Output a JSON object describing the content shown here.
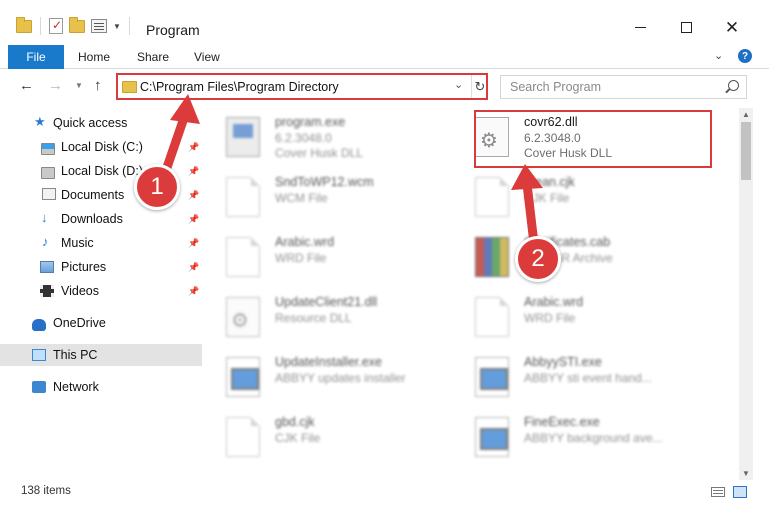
{
  "window": {
    "title": "Program",
    "controls": {
      "minimize": "minimize",
      "maximize": "maximize",
      "close": "✕"
    }
  },
  "ribbon": {
    "tabs": [
      "File",
      "Home",
      "Share",
      "View"
    ]
  },
  "navigation": {
    "address": "C:\\Program Files\\Program Directory",
    "search_placeholder": "Search Program"
  },
  "sidebar": {
    "items": [
      {
        "label": "Quick access",
        "icon": "star-icon",
        "pinned": false
      },
      {
        "label": "Local Disk (C:)",
        "icon": "drive-icon",
        "pinned": true
      },
      {
        "label": "Local Disk (D:)",
        "icon": "drive-icon",
        "pinned": true
      },
      {
        "label": "Documents",
        "icon": "documents-icon",
        "pinned": true
      },
      {
        "label": "Downloads",
        "icon": "download-icon",
        "pinned": true
      },
      {
        "label": "Music",
        "icon": "music-icon",
        "pinned": true
      },
      {
        "label": "Pictures",
        "icon": "pictures-icon",
        "pinned": true
      },
      {
        "label": "Videos",
        "icon": "videos-icon",
        "pinned": true
      },
      {
        "label": "OneDrive",
        "icon": "cloud-icon",
        "pinned": false
      },
      {
        "label": "This PC",
        "icon": "computer-icon",
        "pinned": false,
        "selected": true
      },
      {
        "label": "Network",
        "icon": "network-icon",
        "pinned": false
      }
    ]
  },
  "files": [
    {
      "name": "program.exe",
      "line2": "6.2.3048.0",
      "line3": "Cover Husk DLL",
      "icon": "program-icon",
      "blurred": true
    },
    {
      "name": "covr62.dll",
      "line2": "6.2.3048.0",
      "line3": "Cover Husk DLL",
      "icon": "dll-icon",
      "blurred": false
    },
    {
      "name": "SndToWP12.wcm",
      "line2": "WCM File",
      "line3": "",
      "icon": "document-icon",
      "blurred": true
    },
    {
      "name": "arean.cjk",
      "line2": "CJK File",
      "line3": "",
      "icon": "document-icon",
      "blurred": true
    },
    {
      "name": "Arabic.wrd",
      "line2": "WRD File",
      "line3": "",
      "icon": "document-icon",
      "blurred": true
    },
    {
      "name": "Certificates.cab",
      "line2": "WinRAR Archive",
      "line3": "",
      "icon": "archive-icon",
      "blurred": true
    },
    {
      "name": "UpdateClient21.dll",
      "line2": "Resource DLL",
      "line3": "",
      "icon": "dll-icon",
      "blurred": true
    },
    {
      "name": "Arabic.wrd",
      "line2": "WRD File",
      "line3": "",
      "icon": "document-icon",
      "blurred": true
    },
    {
      "name": "UpdateInstaller.exe",
      "line2": "ABBYY updates installer",
      "line3": "",
      "icon": "application-icon",
      "blurred": true
    },
    {
      "name": "AbbyySTI.exe",
      "line2": "ABBYY sti event hand...",
      "line3": "",
      "icon": "application-icon",
      "blurred": true
    },
    {
      "name": "gbd.cjk",
      "line2": "CJK File",
      "line3": "",
      "icon": "document-icon",
      "blurred": true
    },
    {
      "name": "FineExec.exe",
      "line2": "ABBYY background ave...",
      "line3": "",
      "icon": "application-icon",
      "blurred": true
    }
  ],
  "status": {
    "item_count": "138 items"
  },
  "callouts": {
    "step1": "1",
    "step2": "2"
  },
  "colors": {
    "accent": "#1979ca",
    "annotation": "#dc3b3b"
  }
}
